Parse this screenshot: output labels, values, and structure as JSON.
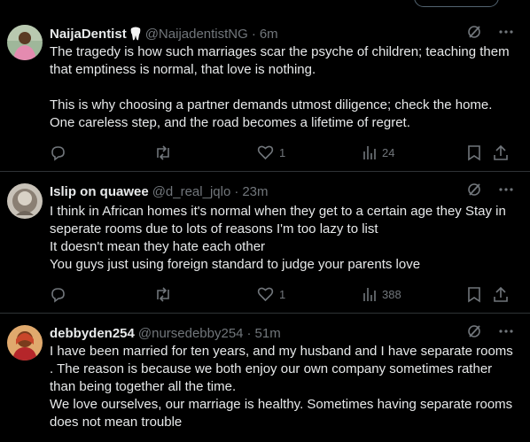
{
  "tweets": [
    {
      "name": "NaijaDentist",
      "handle": "@NaijadentistNG",
      "time": "6m",
      "paragraphs": [
        "The tragedy is how such marriages scar the psyche of children; teaching them that emptiness is normal, that love is nothing.",
        "This is why choosing a partner demands utmost diligence; check the home. One careless step, and the road becomes a lifetime of regret."
      ],
      "likes": "1",
      "views": "24"
    },
    {
      "name": "Islip on quawee",
      "handle": "@d_real_jqlo",
      "time": "23m",
      "lines": [
        "I think in African homes it's normal when they get to a certain age they Stay in seperate rooms due to lots of reasons I'm too lazy to list",
        "It doesn't mean they hate each other",
        "You guys just using foreign standard to judge your parents love"
      ],
      "likes": "1",
      "views": "388"
    },
    {
      "name": "debbyden254",
      "handle": "@nursedebby254",
      "time": "51m",
      "lines": [
        "I have been married for ten years, and my husband and I have separate rooms . The reason is because we both enjoy our own company sometimes rather than being together all the time.",
        "We love ourselves, our marriage is healthy. Sometimes having separate rooms does not mean trouble"
      ]
    }
  ],
  "colors": {
    "background": "#000000",
    "text": "#e7e9ea",
    "muted": "#71767b",
    "divider": "#2f3336"
  },
  "icons": [
    "tooth-icon",
    "grok-icon",
    "more-icon",
    "reply-icon",
    "retweet-icon",
    "like-icon",
    "views-icon",
    "bookmark-icon",
    "share-icon"
  ]
}
